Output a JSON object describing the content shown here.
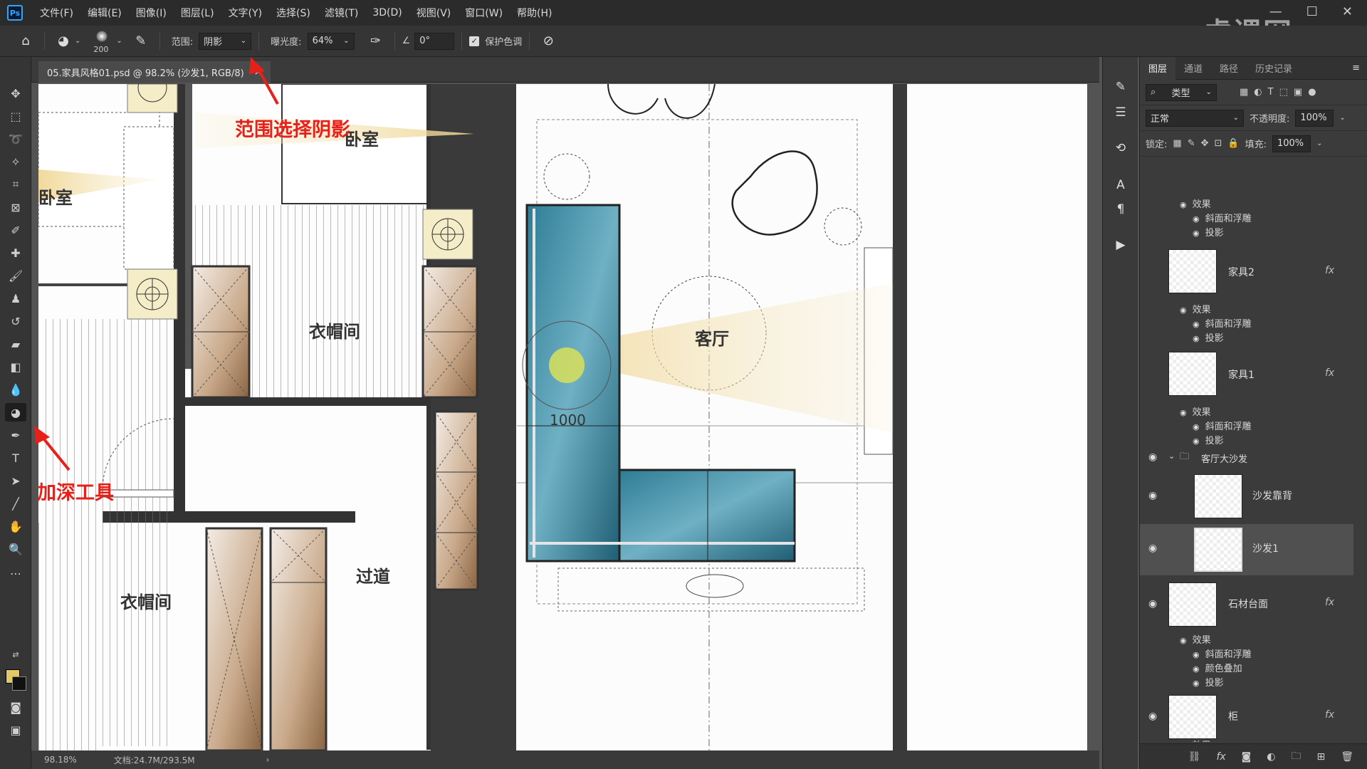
{
  "app": {
    "logo": "Ps"
  },
  "menu": [
    "文件(F)",
    "编辑(E)",
    "图像(I)",
    "图层(L)",
    "文字(Y)",
    "选择(S)",
    "滤镜(T)",
    "3D(D)",
    "视图(V)",
    "窗口(W)",
    "帮助(H)"
  ],
  "watermark": "虎课网",
  "options": {
    "brush_size": "200",
    "range_label": "范围:",
    "range_value": "阴影",
    "exposure_label": "曝光度:",
    "exposure_value": "64%",
    "angle_value": "0°",
    "protect_tones_label": "保护色调"
  },
  "document": {
    "tab_title": "05.家具风格01.psd @ 98.2% (沙发1, RGB/8)",
    "close": "×"
  },
  "status": {
    "zoom": "98.18%",
    "doc_size": "文档:24.7M/293.5M",
    "arrow": "›"
  },
  "annotations": {
    "range_shadow": "范围选择阴影",
    "burn_tool": "加深工具"
  },
  "plan_labels": {
    "bedroom_left": "卧室",
    "bedroom_top": "卧室",
    "cloakroom_mid": "衣帽间",
    "cloakroom_bottom": "衣帽间",
    "corridor": "过道",
    "living_room": "客厅",
    "dimension": "1000"
  },
  "panel": {
    "tabs": [
      "图层",
      "通道",
      "路径",
      "历史记录"
    ],
    "filter_kind": "类型",
    "blend_mode": "正常",
    "opacity_label": "不透明度:",
    "opacity_value": "100%",
    "lock_label": "锁定:",
    "fill_label": "填充:",
    "fill_value": "100%"
  },
  "layers": {
    "top_effect": "效果",
    "top_bevel": "斜面和浮雕",
    "top_shadow": "投影",
    "furniture2": "家具2",
    "furniture2_effect": "效果",
    "furniture2_bevel": "斜面和浮雕",
    "furniture2_shadow": "投影",
    "furniture1": "家具1",
    "furniture1_effect": "效果",
    "furniture1_bevel": "斜面和浮雕",
    "furniture1_shadow": "投影",
    "group_sofa": "客厅大沙发",
    "sofa_back": "沙发靠背",
    "sofa1": "沙发1",
    "stone": "石材台面",
    "stone_effect": "效果",
    "stone_bevel": "斜面和浮雕",
    "stone_color": "颜色叠加",
    "stone_shadow": "投影",
    "cabinet": "柜",
    "cabinet_effect": "效果",
    "fx": "fx"
  },
  "colors": {
    "accent_red": "#e8201a",
    "sofa_blue": "#3f8da3",
    "wardrobe_brown": "#a07a55",
    "light_yellow": "#f1e3b0"
  }
}
